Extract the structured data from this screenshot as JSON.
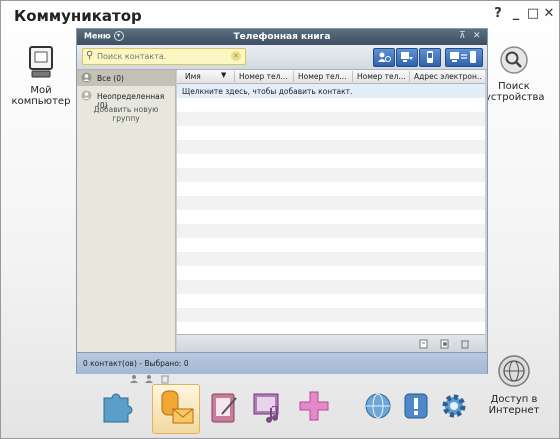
{
  "app": {
    "title": "Коммуникатор",
    "help": "?",
    "minimize": "_",
    "maximize": "□",
    "close": "✕"
  },
  "left_tool": {
    "label_line1": "Мой",
    "label_line2": "компьютер"
  },
  "right_tools": {
    "search": {
      "label_line1": "Поиск",
      "label_line2": "устройства"
    },
    "internet": {
      "label_line1": "Доступ в",
      "label_line2": "Интернет"
    }
  },
  "phonebook": {
    "menu_label": "Меню",
    "title": "Телефонная книга",
    "search_placeholder": "Поиск контакта.",
    "groups": [
      {
        "label": "Все (0)"
      },
      {
        "label": "Неопределенная (0)"
      }
    ],
    "add_group_line1": "Добавить новую",
    "add_group_line2": "группу",
    "columns": [
      "Имя",
      "Номер тел...",
      "Номер тел...",
      "Номер тел...",
      "Адрес электрон..."
    ],
    "add_contact_hint": "Щелкните здесь, чтобы добавить контакт.",
    "status": "0 контакт(ов) - Выбрано: 0"
  },
  "colors": {
    "accent": "#3a6db5",
    "title_bar": "#4a5d70",
    "status_bar": "#b0c2da"
  },
  "dock_icons": [
    "puzzle-icon",
    "contacts-messages-icon",
    "notes-icon",
    "media-icon",
    "plus-icon",
    "globe-icon",
    "alert-icon",
    "gear-icon"
  ]
}
